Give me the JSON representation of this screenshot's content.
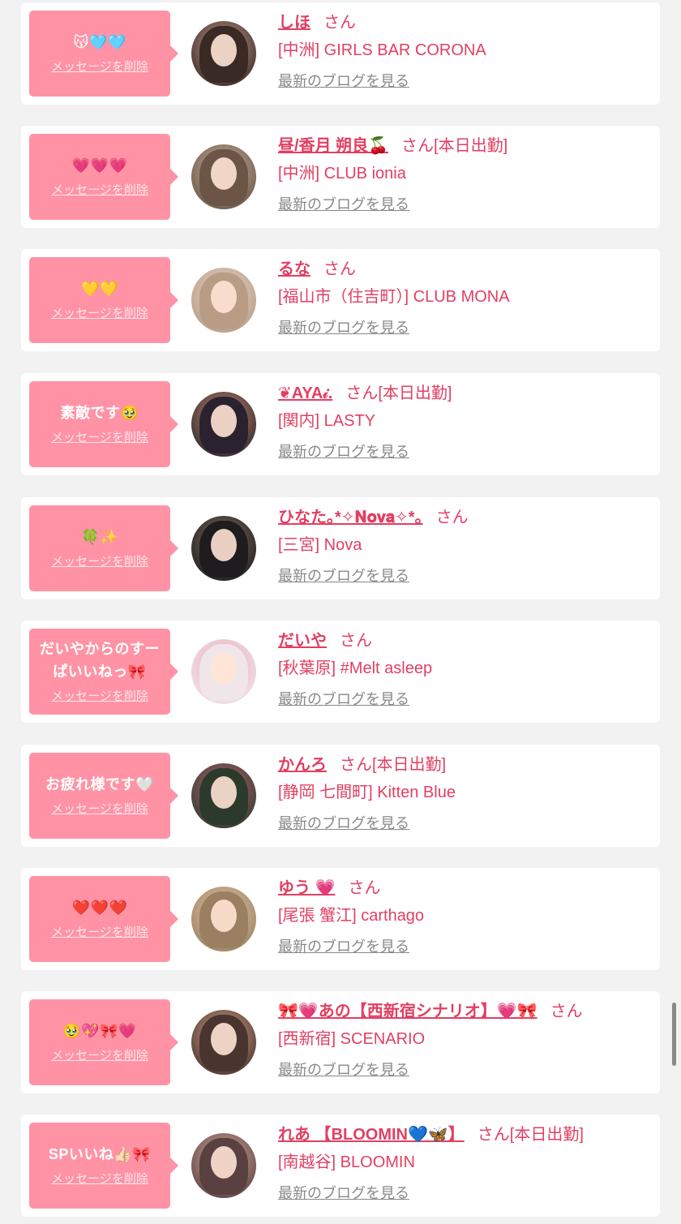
{
  "labels": {
    "delete": "メッセージを削除",
    "blog": "最新のブログを見る",
    "san": "さん"
  },
  "items": [
    {
      "message": "😽🩵🩵",
      "name": "しほ",
      "today": "",
      "shop": "[中洲] GIRLS BAR CORONA",
      "avatar": [
        "#3a2a26",
        "#c9a48f"
      ]
    },
    {
      "message": "💗💗💗",
      "name": "昼/香月 朔良🍒",
      "today": "[本日出勤]",
      "shop": "[中洲] CLUB ionia",
      "avatar": [
        "#6b5546",
        "#cdb8a6"
      ]
    },
    {
      "message": "💛💛",
      "name": "るな",
      "today": "",
      "shop": "[福山市（住吉町）] CLUB MONA",
      "avatar": [
        "#b89c86",
        "#e7d8cb"
      ]
    },
    {
      "message": "素敵です🥹",
      "name": "❦AYA𝒾.",
      "today": "[本日出勤]",
      "shop": "[関内] LASTY",
      "avatar": [
        "#2b2230",
        "#d59a6e"
      ]
    },
    {
      "message": "🍀✨",
      "name": "ひなた｡*✧𝐍𝐨𝐯𝐚✧*｡",
      "today": "",
      "shop": "[三宮] Nova",
      "avatar": [
        "#1e1c1f",
        "#8a7464"
      ]
    },
    {
      "message": "だいやからのすー\nぱいいねっ🎀",
      "name": "だいや",
      "today": "",
      "shop": "[秋葉原] #Melt asleep",
      "avatar": [
        "#f0e6ea",
        "#e8a4b6"
      ]
    },
    {
      "message": "お疲れ様です🤍",
      "name": "かんろ",
      "today": "[本日出勤]",
      "shop": "[静岡 七間町] Kitten Blue",
      "avatar": [
        "#2c3a2c",
        "#c66a7a"
      ]
    },
    {
      "message": "❤️❤️❤️",
      "name": "ゆう 💗",
      "today": "",
      "shop": "[尾張 蟹江] carthago",
      "avatar": [
        "#9a8060",
        "#e9cbb0"
      ]
    },
    {
      "message": "🥹💖🎀💗",
      "name": "🎀💗あの【西新宿シナリオ】💗🎀",
      "today": "",
      "shop": "[西新宿] SCENARIO",
      "avatar": [
        "#4a3430",
        "#d9a98c"
      ]
    },
    {
      "message": "SPいいね👍🏻🎀",
      "name": "れあ 【BLOOMIN💙🦋】",
      "today": "[本日出勤]",
      "shop": "[南越谷] BLOOMIN",
      "avatar": [
        "#5a4040",
        "#e0b7a8"
      ]
    }
  ]
}
